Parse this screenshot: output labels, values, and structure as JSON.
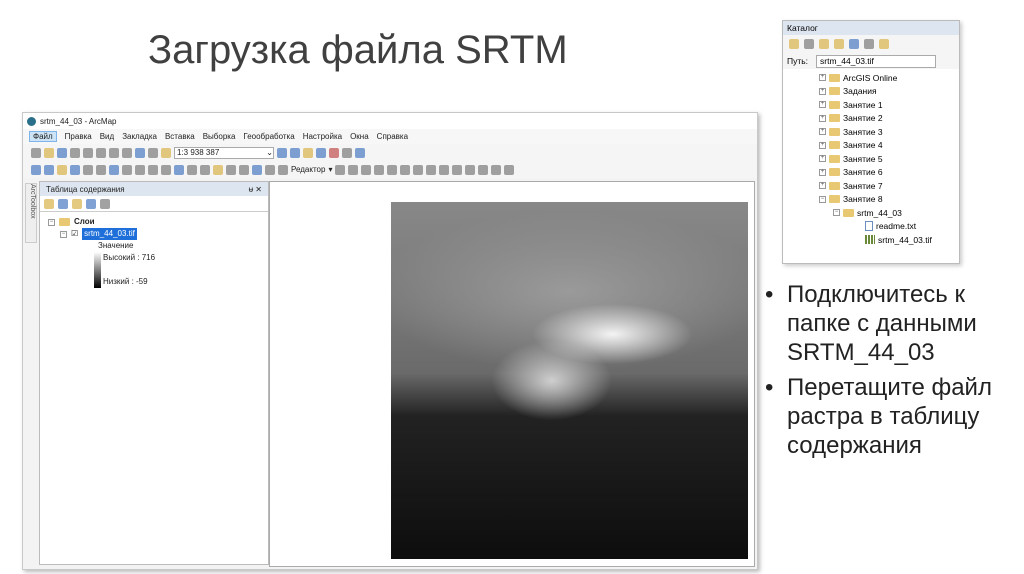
{
  "slide_title": "Загрузка файла SRTM",
  "arcmap": {
    "window_title": "srtm_44_03 - ArcMap",
    "menu": [
      "Файл",
      "Правка",
      "Вид",
      "Закладка",
      "Вставка",
      "Выборка",
      "Геообработка",
      "Настройка",
      "Окна",
      "Справка"
    ],
    "scale": "1:3 938 387",
    "editor": "Редактор",
    "arctoolbox": "ArcToolbox",
    "toc": {
      "title": "Таблица содержания",
      "group": "Слои",
      "layer": "srtm_44_03.tif",
      "legend_title": "Значение",
      "high": "Высокий : 716",
      "low": "Низкий : -59"
    }
  },
  "catalog": {
    "title": "Каталог",
    "path_label": "Путь:",
    "path_value": "srtm_44_03.tif",
    "items": [
      "ArcGIS Online",
      "Задания",
      "Занятие 1",
      "Занятие 2",
      "Занятие 3",
      "Занятие 4",
      "Занятие 5",
      "Занятие 6",
      "Занятие 7",
      "Занятие 8"
    ],
    "subfolder": "srtm_44_03",
    "files": [
      "readme.txt",
      "srtm_44_03.tif"
    ]
  },
  "bullets": [
    "Подключитесь к папке с данными SRTM_44_03",
    "Перетащите файл растра в таблицу содержания"
  ]
}
